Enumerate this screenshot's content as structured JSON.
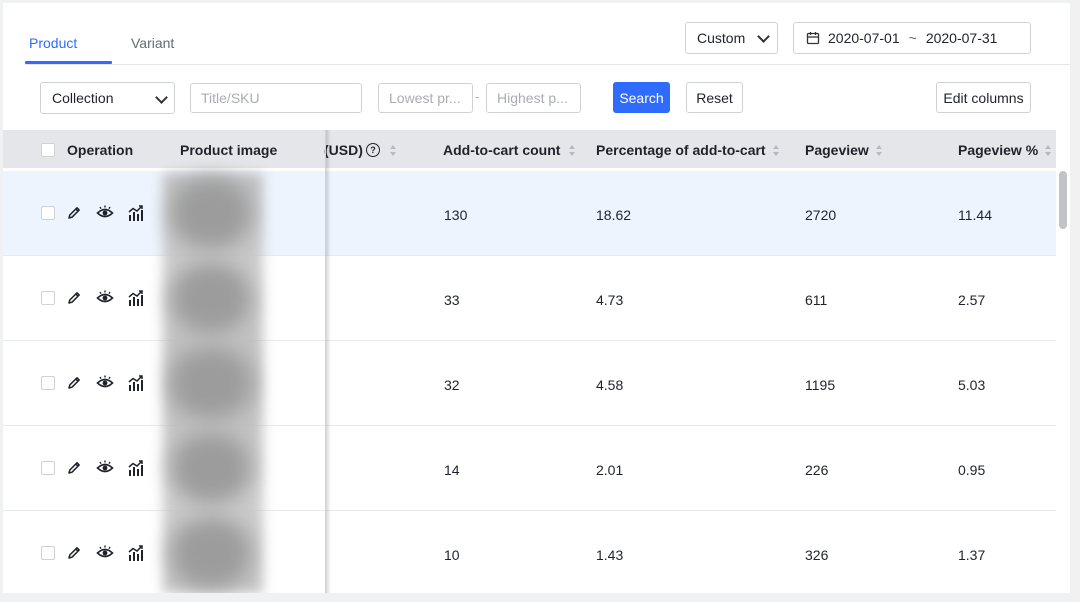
{
  "tabs": [
    {
      "label": "Product",
      "active": true
    },
    {
      "label": "Variant",
      "active": false
    }
  ],
  "date_filter": {
    "range_select": "Custom",
    "start": "2020-07-01",
    "separator": "~",
    "end": "2020-07-31",
    "icon": "calendar-icon"
  },
  "filters": {
    "collection": "Collection",
    "title_sku_placeholder": "Title/SKU",
    "lowest_price_placeholder": "Lowest pr...",
    "range_dash": "-",
    "highest_price_placeholder": "Highest p...",
    "search_label": "Search",
    "reset_label": "Reset",
    "edit_columns_label": "Edit columns"
  },
  "table": {
    "columns": {
      "operation": "Operation",
      "product_image": "Product image",
      "price_partial": "(USD)",
      "add_to_cart": "Add-to-cart count",
      "pct_add_to_cart": "Percentage of add-to-cart",
      "pageview": "Pageview",
      "pageview_pct": "Pageview %"
    },
    "operation_icons": [
      "edit-icon",
      "eye-icon",
      "analytics-icon"
    ],
    "rows": [
      {
        "add_to_cart": "130",
        "pct_add_to_cart": "18.62",
        "pageview": "2720",
        "pageview_pct": "11.44",
        "highlighted": true
      },
      {
        "add_to_cart": "33",
        "pct_add_to_cart": "4.73",
        "pageview": "611",
        "pageview_pct": "2.57"
      },
      {
        "add_to_cart": "32",
        "pct_add_to_cart": "4.58",
        "pageview": "1195",
        "pageview_pct": "5.03"
      },
      {
        "add_to_cart": "14",
        "pct_add_to_cart": "2.01",
        "pageview": "226",
        "pageview_pct": "0.95"
      },
      {
        "add_to_cart": "10",
        "pct_add_to_cart": "1.43",
        "pageview": "326",
        "pageview_pct": "1.37"
      }
    ]
  },
  "colors": {
    "accent": "#2f6bff",
    "header_bg": "#e4e6ea",
    "row_highlight": "#eef4fd"
  }
}
